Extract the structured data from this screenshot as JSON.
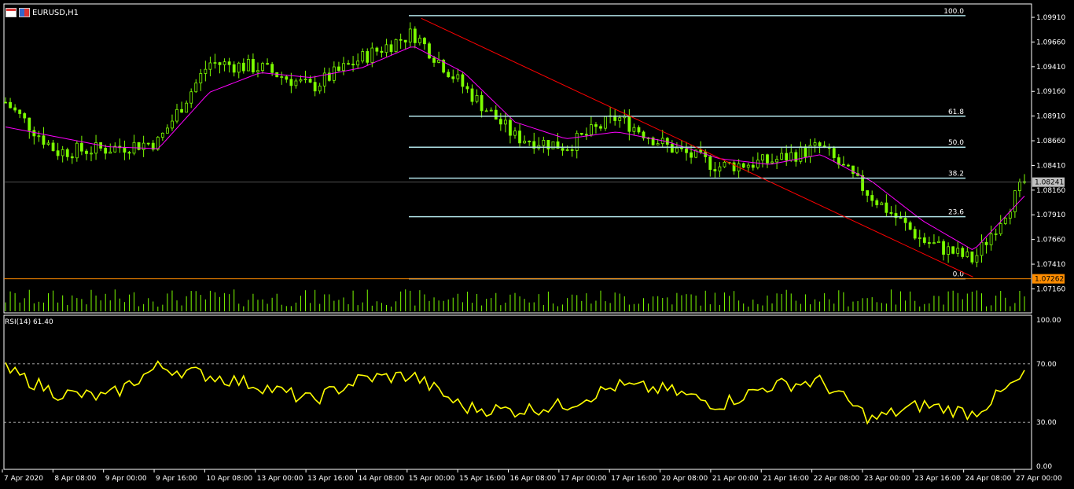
{
  "window": {
    "title": "EURUSD,H1",
    "icons": [
      "chart-window-icon",
      "symbol-flag-icon"
    ]
  },
  "colors": {
    "background": "#000000",
    "bull_candle": "#7CFC00",
    "moving_average": "#FF00FF",
    "trendline": "#FF0000",
    "fib_levels": "#B0E0E6",
    "rsi_line": "#FFFF00",
    "current_price_badge": "#C0C0C0",
    "low_price_badge": "#FF8C00"
  },
  "price_axis": {
    "labels": [
      "1.09910",
      "1.09660",
      "1.09410",
      "1.09160",
      "1.08910",
      "1.08660",
      "1.08410",
      "1.08160",
      "1.07910",
      "1.07660",
      "1.07410",
      "1.07160"
    ],
    "current_price": "1.08241",
    "low_price": "1.07262"
  },
  "fibonacci": {
    "levels": [
      "100.0",
      "61.8",
      "50.0",
      "38.2",
      "23.6",
      "0.0"
    ]
  },
  "rsi": {
    "label": "RSI(14) 61.40",
    "axis_labels": [
      "100.00",
      "70.00",
      "30.00",
      "0.00"
    ]
  },
  "time_axis": {
    "labels": [
      "7 Apr 2020",
      "8 Apr 08:00",
      "9 Apr 00:00",
      "9 Apr 16:00",
      "10 Apr 08:00",
      "13 Apr 00:00",
      "13 Apr 16:00",
      "14 Apr 08:00",
      "15 Apr 00:00",
      "15 Apr 16:00",
      "16 Apr 08:00",
      "17 Apr 00:00",
      "17 Apr 16:00",
      "20 Apr 08:00",
      "21 Apr 00:00",
      "21 Apr 16:00",
      "22 Apr 08:00",
      "23 Apr 00:00",
      "23 Apr 16:00",
      "24 Apr 08:00",
      "27 Apr 00:00"
    ]
  },
  "chart_data": [
    {
      "type": "candlestick",
      "symbol": "EURUSD",
      "timeframe": "H1",
      "ylim": [
        1.0706,
        1.0999
      ],
      "x": [
        "7 Apr 2020",
        "8 Apr 08:00",
        "9 Apr 00:00",
        "9 Apr 16:00",
        "10 Apr 08:00",
        "13 Apr 00:00",
        "13 Apr 16:00",
        "14 Apr 08:00",
        "15 Apr 00:00",
        "15 Apr 16:00",
        "16 Apr 08:00",
        "17 Apr 00:00",
        "17 Apr 16:00",
        "20 Apr 08:00",
        "21 Apr 00:00",
        "21 Apr 16:00",
        "22 Apr 08:00",
        "23 Apr 00:00",
        "23 Apr 16:00",
        "24 Apr 08:00",
        "27 Apr 00:00"
      ],
      "close": [
        1.0905,
        1.0855,
        1.0858,
        1.0865,
        1.0945,
        1.094,
        1.092,
        1.095,
        1.0975,
        1.092,
        1.087,
        1.086,
        1.089,
        1.086,
        1.084,
        1.0845,
        1.086,
        1.081,
        1.0765,
        1.0745,
        1.0824
      ],
      "high": [
        1.093,
        1.089,
        1.088,
        1.092,
        1.096,
        1.097,
        1.0955,
        1.0975,
        1.0993,
        1.095,
        1.09,
        1.088,
        1.0905,
        1.089,
        1.0875,
        1.087,
        1.0885,
        1.0835,
        1.084,
        1.076,
        1.0832
      ],
      "low": [
        1.088,
        1.083,
        1.084,
        1.0845,
        1.092,
        1.0925,
        1.0905,
        1.093,
        1.095,
        1.0855,
        1.084,
        1.082,
        1.0855,
        1.084,
        1.082,
        1.0825,
        1.084,
        1.079,
        1.075,
        1.0726,
        1.08
      ],
      "moving_average": [
        1.088,
        1.087,
        1.086,
        1.0858,
        1.0915,
        1.0935,
        1.093,
        1.094,
        1.0962,
        1.0935,
        1.0885,
        1.0868,
        1.0875,
        1.0865,
        1.0848,
        1.0842,
        1.0852,
        1.0825,
        1.0785,
        1.0755,
        1.081
      ],
      "fibonacci_retracement": {
        "high": 1.09927,
        "low": 1.07262,
        "levels": {
          "100.0": 1.09927,
          "61.8": 1.08908,
          "50.0": 1.08595,
          "38.2": 1.08281,
          "23.6": 1.07891,
          "0.0": 1.07262
        }
      },
      "trendline": {
        "from": {
          "x": "15 Apr 00:00",
          "y": 1.099
        },
        "to": {
          "x": "24 Apr 08:00",
          "y": 1.0728
        }
      }
    },
    {
      "type": "line",
      "name": "RSI(14)",
      "ylim": [
        0,
        100
      ],
      "levels": [
        70,
        30
      ],
      "x": [
        "7 Apr 2020",
        "8 Apr 08:00",
        "9 Apr 00:00",
        "9 Apr 16:00",
        "10 Apr 08:00",
        "13 Apr 00:00",
        "13 Apr 16:00",
        "14 Apr 08:00",
        "15 Apr 00:00",
        "15 Apr 16:00",
        "16 Apr 08:00",
        "17 Apr 00:00",
        "17 Apr 16:00",
        "20 Apr 08:00",
        "21 Apr 00:00",
        "21 Apr 16:00",
        "22 Apr 08:00",
        "23 Apr 00:00",
        "23 Apr 16:00",
        "24 Apr 08:00",
        "27 Apr 00:00"
      ],
      "values": [
        66,
        50,
        47,
        68,
        62,
        55,
        45,
        60,
        62,
        40,
        38,
        42,
        55,
        52,
        42,
        55,
        58,
        32,
        42,
        36,
        61.4
      ]
    }
  ]
}
